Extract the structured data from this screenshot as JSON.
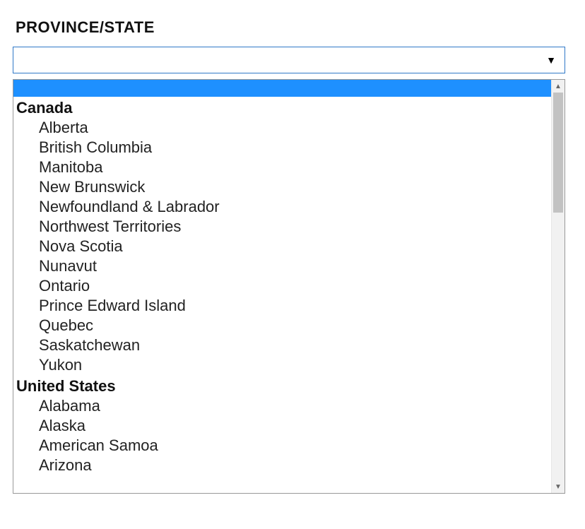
{
  "label": "PROVINCE/STATE",
  "select": {
    "value": "",
    "arrow_glyph": "▼"
  },
  "dropdown": {
    "highlighted_index": 0,
    "groups": [
      {
        "label": "Canada",
        "options": [
          "Alberta",
          "British Columbia",
          "Manitoba",
          "New Brunswick",
          "Newfoundland & Labrador",
          "Northwest Territories",
          "Nova Scotia",
          "Nunavut",
          "Ontario",
          "Prince Edward Island",
          "Quebec",
          "Saskatchewan",
          "Yukon"
        ]
      },
      {
        "label": "United States",
        "options": [
          "Alabama",
          "Alaska",
          "American Samoa",
          "Arizona"
        ]
      }
    ]
  },
  "scrollbar": {
    "up_glyph": "▲",
    "down_glyph": "▼"
  }
}
